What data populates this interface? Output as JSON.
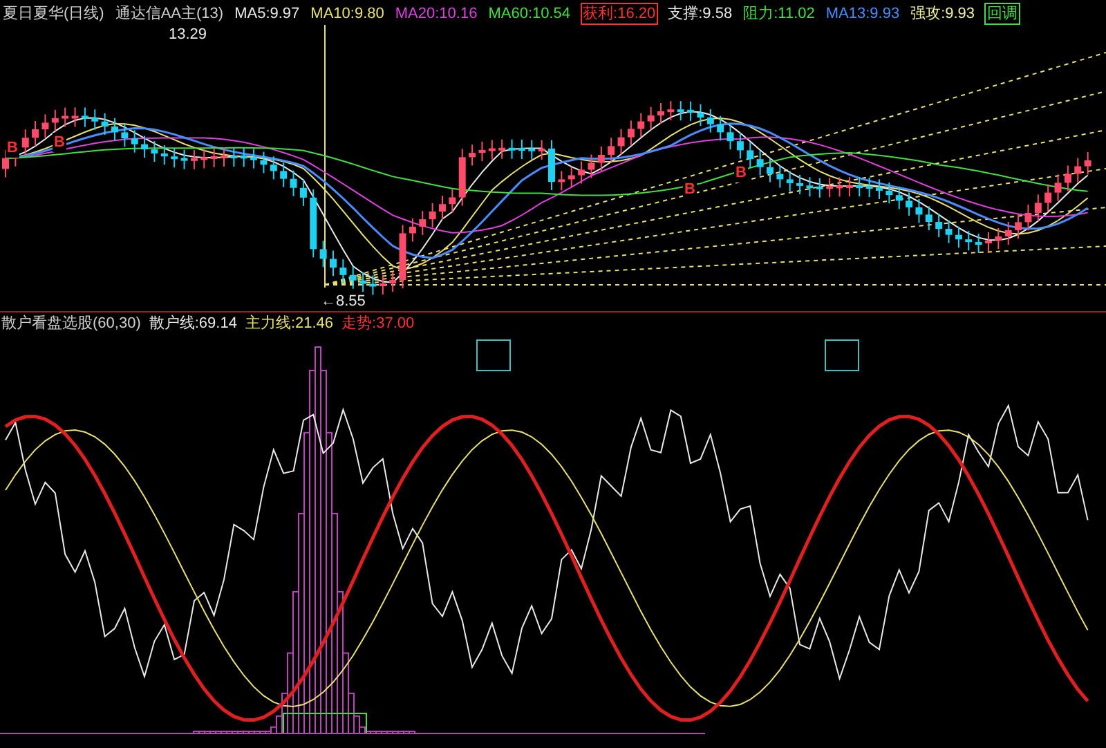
{
  "price_panel": {
    "legend": [
      {
        "text": "夏日夏华(日线)",
        "color": "#d0d0d0",
        "boxed": false
      },
      {
        "text": "通达信AA主(13)",
        "color": "#d0d0d0",
        "boxed": false
      },
      {
        "text": "MA5:9.97",
        "color": "#e8e8e8",
        "boxed": false
      },
      {
        "text": "MA10:9.80",
        "color": "#e8e070",
        "boxed": false
      },
      {
        "text": "MA20:10.16",
        "color": "#e040e0",
        "boxed": false
      },
      {
        "text": "MA60:10.54",
        "color": "#40e040",
        "boxed": false
      },
      {
        "text": "获利:16.20",
        "color": "#ff3030",
        "boxed": true
      },
      {
        "text": "支撑:9.58",
        "color": "#e8e8e8",
        "boxed": false
      },
      {
        "text": "阻力:11.02",
        "color": "#40e040",
        "boxed": false
      },
      {
        "text": "MA13:9.93",
        "color": "#4a8cff",
        "boxed": false
      },
      {
        "text": "强攻:9.93",
        "color": "#f0f0a0",
        "boxed": false
      },
      {
        "text": "回调",
        "color": "#40e040",
        "boxed": true
      }
    ],
    "high_label": "13.29",
    "low_label": "←8.55",
    "markers": [
      {
        "text": "B"
      },
      {
        "text": "B"
      },
      {
        "text": "B"
      },
      {
        "text": "B"
      }
    ]
  },
  "indicator_panel": {
    "legend": [
      {
        "text": "散户看盘选股(60,30)",
        "color": "#d0d0d0"
      },
      {
        "text": "散户线:69.14",
        "color": "#e8e8e8"
      },
      {
        "text": "主力线:21.46",
        "color": "#e8e070"
      },
      {
        "text": "走势:37.00",
        "color": "#ff3030"
      }
    ]
  }
}
